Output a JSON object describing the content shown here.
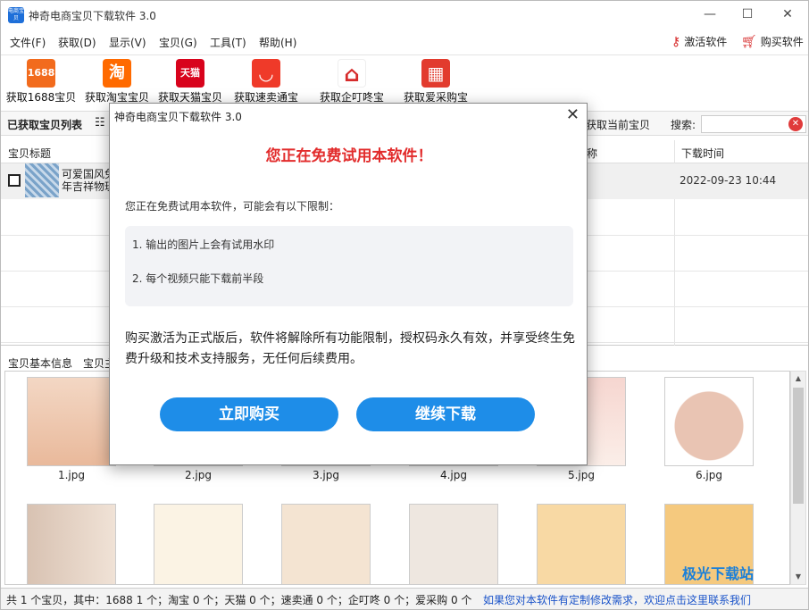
{
  "window": {
    "title": "神奇电商宝贝下载软件 3.0",
    "icon_text": "电商宝贝",
    "minimize": "—",
    "maximize": "☐",
    "close": "✕"
  },
  "menu": {
    "items": [
      "文件(F)",
      "获取(D)",
      "显示(V)",
      "宝贝(G)",
      "工具(T)",
      "帮助(H)"
    ],
    "activate": "激活软件",
    "buy": "购买软件"
  },
  "toolbar": {
    "buttons": [
      {
        "label": "获取1688宝贝",
        "icon": "1688-icon",
        "icon_text": "1688",
        "color": "#f26b1d"
      },
      {
        "label": "获取淘宝宝贝",
        "icon": "taobao-icon",
        "icon_text": "淘",
        "color": "#ff6a00"
      },
      {
        "label": "获取天猫宝贝",
        "icon": "tmall-icon",
        "icon_text": "天猫",
        "color": "#d8031c"
      },
      {
        "label": "获取速卖通宝贝",
        "icon": "aliexpress-icon",
        "icon_text": "◡",
        "color": "#ef3a29"
      },
      {
        "label": "获取企叮咚宝贝",
        "icon": "qidingdong-icon",
        "icon_text": "⌂",
        "color": "#ffffff"
      },
      {
        "label": "获取爱采购宝贝",
        "icon": "aicaigou-icon",
        "icon_text": "▦",
        "color": "#e23b2e"
      }
    ]
  },
  "listbar": {
    "label": "已获取宝贝列表",
    "current": "获取当前宝贝",
    "search_label": "搜索:",
    "search_value": ""
  },
  "table": {
    "headers": [
      "宝贝标题",
      "称",
      "下载时间"
    ],
    "rows": [
      {
        "title": "可爱国风兔年吉祥物玩",
        "time": "2022-09-23 10:44"
      }
    ]
  },
  "tabs": [
    "宝贝基本信息",
    "宝贝主"
  ],
  "gallery": {
    "images": [
      "1.jpg",
      "2.jpg",
      "3.jpg",
      "4.jpg",
      "5.jpg",
      "6.jpg"
    ]
  },
  "status": {
    "summary": "共 1 个宝贝，其中：1688 1 个；淘宝 0 个；天猫 0 个；速卖通 0 个；企叮咚 0 个；爱采购 0 个",
    "custom_link": "如果您对本软件有定制修改需求，欢迎点击这里联系我们"
  },
  "watermark": "极光下载站",
  "dialog": {
    "title": "神奇电商宝贝下载软件 3.0",
    "close": "✕",
    "headline": "您正在免费试用本软件！",
    "intro": "您正在免费试用本软件，可能会有以下限制：",
    "limits": [
      "1. 输出的图片上会有试用水印",
      "2. 每个视频只能下载前半段"
    ],
    "description": "购买激活为正式版后，软件将解除所有功能限制，授权码永久有效，并享受终生免费升级和技术支持服务，无任何后续费用。",
    "buy_button": "立即购买",
    "continue_button": "继续下载"
  }
}
